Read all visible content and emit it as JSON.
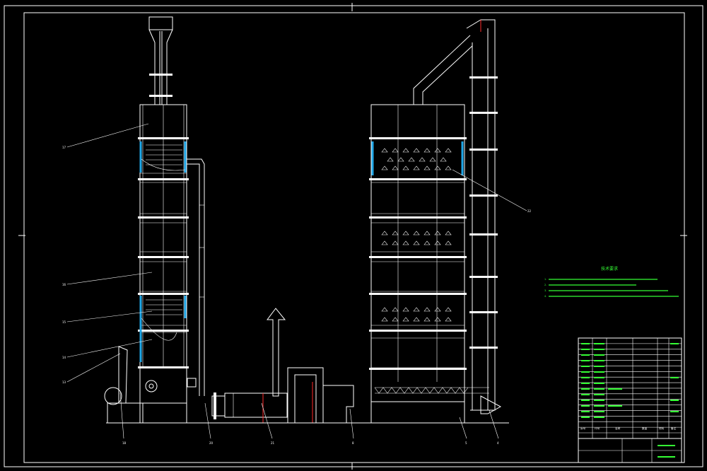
{
  "drawing": {
    "palette": {
      "background": "#000000",
      "lines": "#ffffff",
      "notes": "#34ff34",
      "highlight": "#1fa7e8",
      "centerline": "#ff2a2a"
    },
    "callouts": [
      "17",
      "16",
      "15",
      "14",
      "13",
      "18",
      "20",
      "21",
      "8",
      "5",
      "4",
      "22"
    ],
    "notes": {
      "title": "技术要求",
      "lines": [
        "1.",
        "2.",
        "3.",
        "4."
      ]
    },
    "title_block": {
      "headers": [
        "序号",
        "代号",
        "名称",
        "数量",
        "材料",
        "备注"
      ],
      "rows": 17
    }
  }
}
